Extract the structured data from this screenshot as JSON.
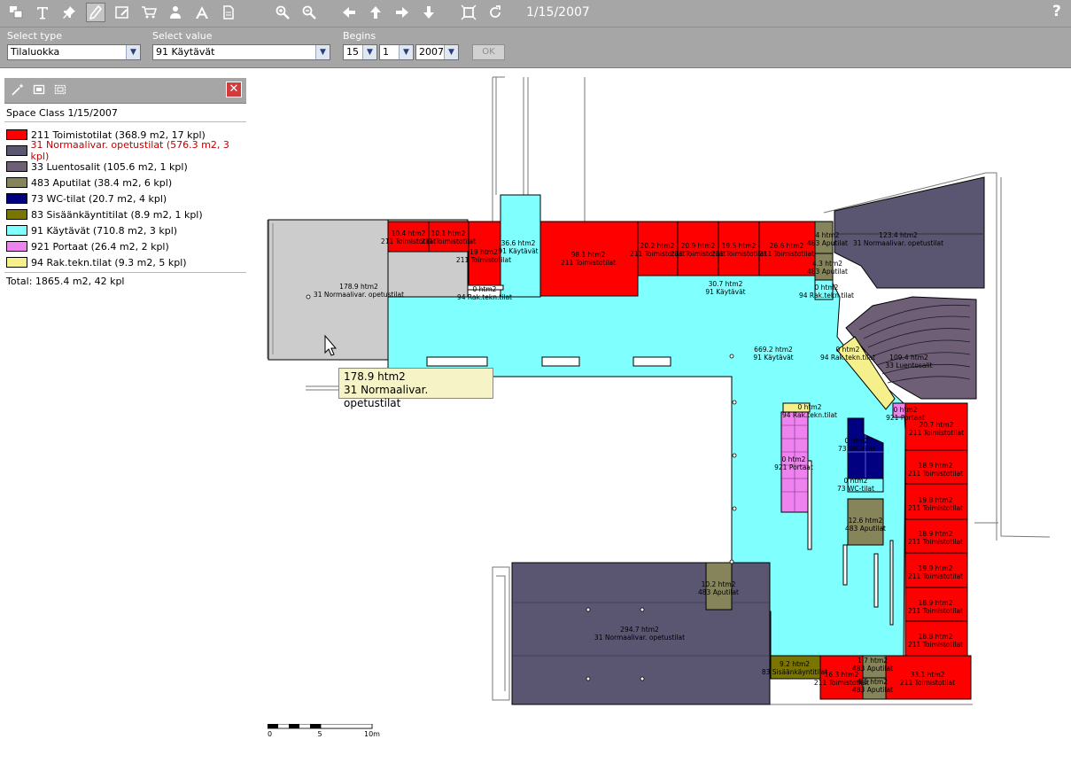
{
  "toolbar": {
    "icons": [
      "layers-icon",
      "text-icon",
      "push-pin-icon",
      "pencil-icon",
      "edit-area-icon",
      "cart-icon",
      "person-icon",
      "font-icon",
      "document-icon",
      "zoom-in-icon",
      "zoom-out-icon",
      "arrow-left-icon",
      "arrow-up-icon",
      "arrow-right-icon",
      "arrow-down-icon",
      "fit-extent-icon",
      "refresh-icon"
    ],
    "date": "1/15/2007",
    "help": "?"
  },
  "filters": {
    "type_label": "Select type",
    "type_value": "Tilaluokka",
    "value_label": "Select value",
    "value_value": "91 Käytävät",
    "begins_label": "Begins",
    "day": "15",
    "month": "1",
    "year": "2007",
    "ok": "OK"
  },
  "legend": {
    "title": "Space Class 1/15/2007",
    "items": [
      {
        "label": "211 Toimistotilat (368.9 m2, 17 kpl)",
        "color": "#ff0000",
        "text_color": "#000000"
      },
      {
        "label": "31 Normaalivar. opetustilat (576.3 m2, 3 kpl)",
        "color": "#5a5672",
        "text_color": "#c00000"
      },
      {
        "label": "33 Luentosalit (105.6 m2, 1 kpl)",
        "color": "#6e5f76",
        "text_color": "#000000"
      },
      {
        "label": "483 Aputilat (38.4 m2, 6 kpl)",
        "color": "#85845a",
        "text_color": "#000000"
      },
      {
        "label": "73 WC-tilat (20.7 m2, 4 kpl)",
        "color": "#000080",
        "text_color": "#000000"
      },
      {
        "label": "83 Sisäänkäyntitilat (8.9 m2, 1 kpl)",
        "color": "#7a7400",
        "text_color": "#000000"
      },
      {
        "label": "91 Käytävät (710.8 m2, 3 kpl)",
        "color": "#80ffff",
        "text_color": "#000000"
      },
      {
        "label": "921 Portaat (26.4 m2, 2 kpl)",
        "color": "#ee82ee",
        "text_color": "#000000"
      },
      {
        "label": "94 Rak.tekn.tilat (9.3 m2, 5 kpl)",
        "color": "#f5f08c",
        "text_color": "#000000"
      }
    ],
    "total": "Total: 1865.4 m2, 42 kpl"
  },
  "rooms": [
    {
      "area": "178.9 htm2",
      "cls": "31 Normaalivar. opetustilat"
    },
    {
      "area": "10.4 htm2",
      "cls": "211 Toimistotilat"
    },
    {
      "area": "10.1 htm2",
      "cls": "211 Toimistotilat"
    },
    {
      "area": "19 htm2",
      "cls": "211 Toimistotilat"
    },
    {
      "area": "36.6 htm2",
      "cls": "91 Käytävät"
    },
    {
      "area": "98.1 htm2",
      "cls": "211 Toimistotilat"
    },
    {
      "area": "20.2 htm2",
      "cls": "211 Toimistotilat"
    },
    {
      "area": "20.9 htm2",
      "cls": "211 Toimistotilat"
    },
    {
      "area": "19.5 htm2",
      "cls": "211 Toimistotilat"
    },
    {
      "area": "26.6 htm2",
      "cls": "211 Toimistotilat"
    },
    {
      "area": "4 htm2",
      "cls": "483 Aputilat"
    },
    {
      "area": "4.3 htm2",
      "cls": "483 Aputilat"
    },
    {
      "area": "123.4 htm2",
      "cls": "31 Normaalivar. opetustilat"
    },
    {
      "area": "30.7 htm2",
      "cls": "91 Käytävät"
    },
    {
      "area": "0 htm2",
      "cls": "94 Rak.tekn.tilat"
    },
    {
      "area": "0 htm2",
      "cls": "94 Rak.tekn.tilat"
    },
    {
      "area": "669.2 htm2",
      "cls": "91 Käytävät"
    },
    {
      "area": "0 htm2",
      "cls": "94 Rak.tekn.tilat"
    },
    {
      "area": "109.4 htm2",
      "cls": "33 Luentosalit"
    },
    {
      "area": "0 htm2",
      "cls": "94 Rak.tekn.tilat"
    },
    {
      "area": "0 htm2",
      "cls": "921 Portaat"
    },
    {
      "area": "20.7 htm2",
      "cls": "211 Toimistotilat"
    },
    {
      "area": "0 htm2",
      "cls": "921 Portaat"
    },
    {
      "area": "18.9 htm2",
      "cls": "211 Toimistotilat"
    },
    {
      "area": "19.8 htm2",
      "cls": "211 Toimistotilat"
    },
    {
      "area": "18.9 htm2",
      "cls": "211 Toimistotilat"
    },
    {
      "area": "19.9 htm2",
      "cls": "211 Toimistotilat"
    },
    {
      "area": "18.9 htm2",
      "cls": "211 Toimistotilat"
    },
    {
      "area": "18.8 htm2",
      "cls": "211 Toimistotilat"
    },
    {
      "area": "12.6 htm2",
      "cls": "483 Aputilat"
    },
    {
      "area": "10.2 htm2",
      "cls": "483 Aputilat"
    },
    {
      "area": "294.7 htm2",
      "cls": "31 Normaalivar. opetustilat"
    },
    {
      "area": "9.2 htm2",
      "cls": "83 Sisäänkäyntitilat"
    },
    {
      "area": "16.3 htm2",
      "cls": "211 Toimistotilat"
    },
    {
      "area": "33.1 htm2",
      "cls": "211 Toimistotilat"
    },
    {
      "area": "1.7 htm2",
      "cls": "483 Aputilat"
    },
    {
      "area": "6.5 htm2",
      "cls": "483 Aputilat"
    },
    {
      "area": "0 htm2",
      "cls": "73 WC-tilat"
    },
    {
      "area": "0 htm2",
      "cls": "73 WC-tilat"
    }
  ],
  "tooltip": {
    "area": "178.9 htm2",
    "cls": "31 Normaalivar. opetustilat"
  },
  "scale": {
    "t0": "0",
    "t5": "5",
    "t10": "10m"
  }
}
